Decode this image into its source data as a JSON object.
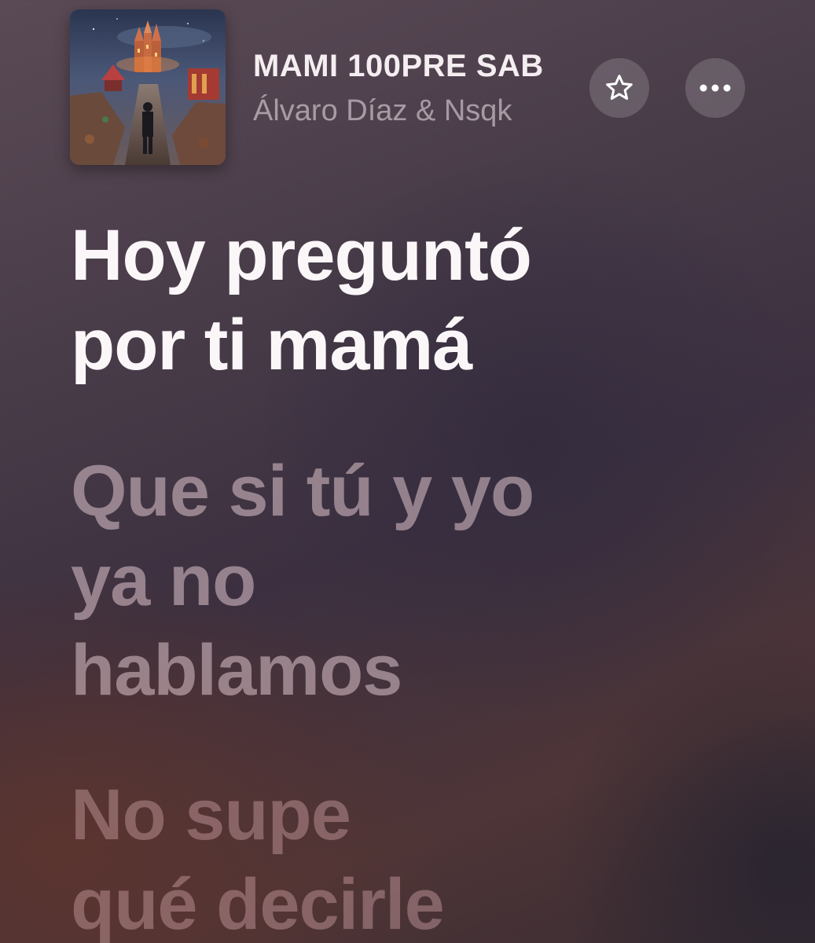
{
  "now_playing": {
    "title": "MAMI 100PRE SAB",
    "artist": "Álvaro Díaz & Nsqk",
    "artwork": "album-artwork"
  },
  "controls": {
    "favorite_icon": "star-outline-icon",
    "more_icon": "ellipsis-icon"
  },
  "lyrics": [
    {
      "text": "Hoy preguntó\npor ti mamá",
      "state": "active"
    },
    {
      "text": "Que si tú y yo\nya no\nhablamos",
      "state": "upcoming"
    },
    {
      "text": "No supe\nqué decirle",
      "state": "upcoming"
    }
  ],
  "colors": {
    "active_lyric": "#fbf7f9",
    "upcoming_lyric": "#dec4cc",
    "button_bg": "#ffffff29"
  }
}
